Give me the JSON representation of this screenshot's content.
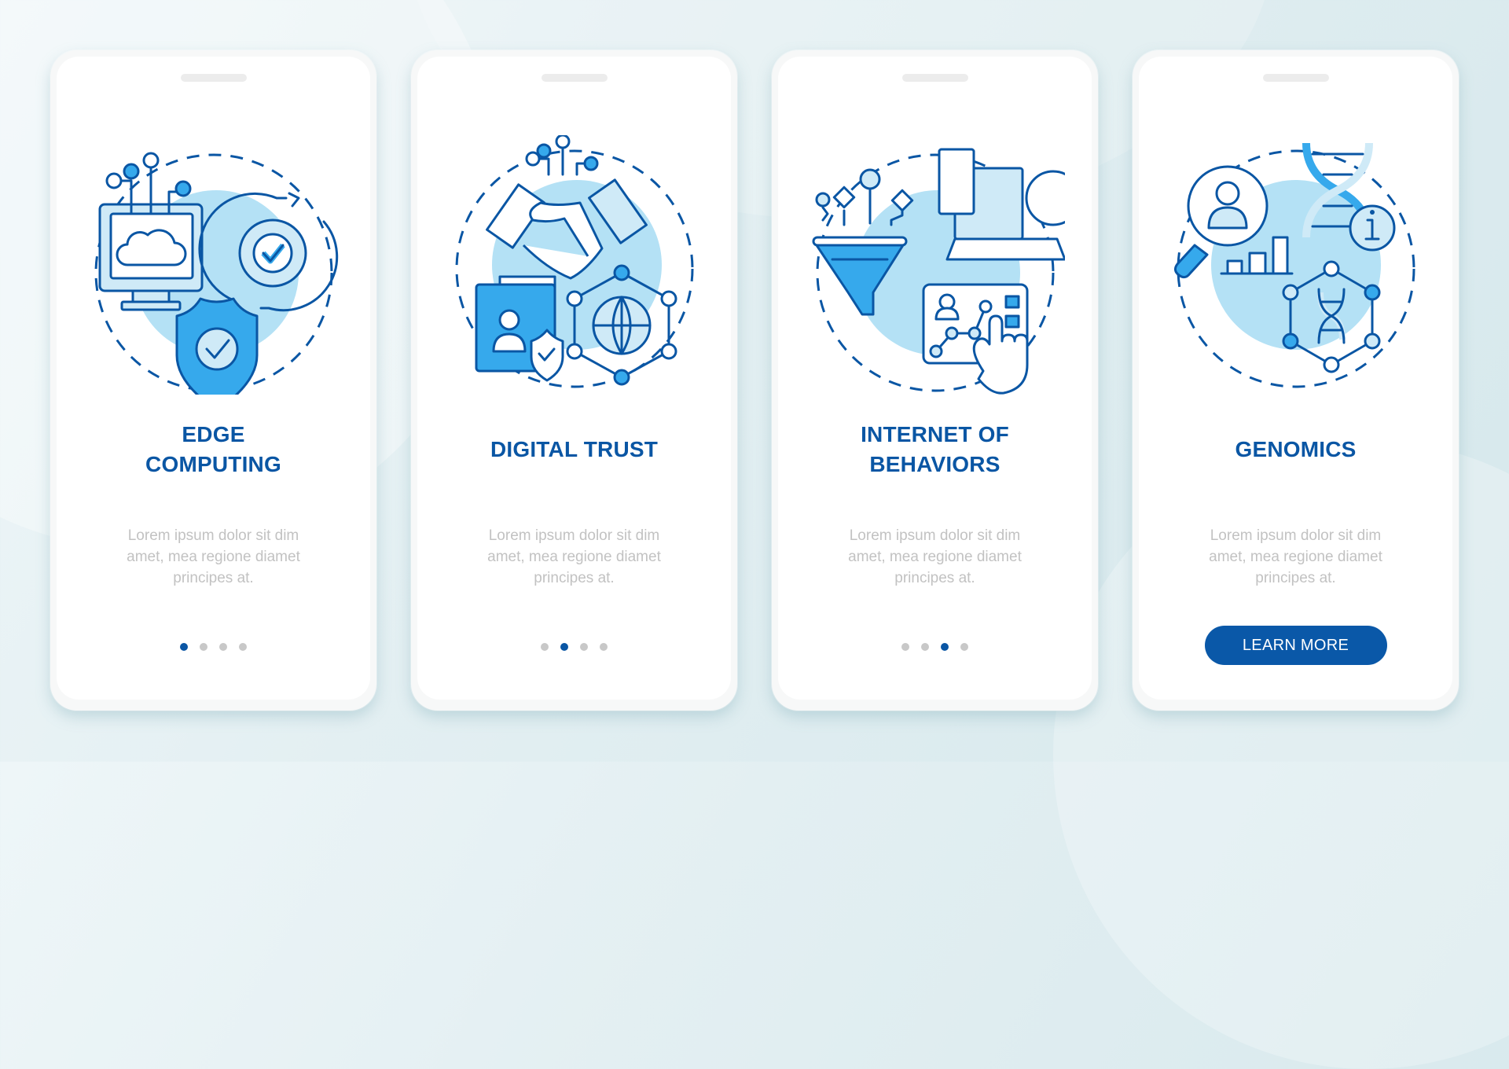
{
  "colors": {
    "accent": "#0a56a4",
    "icon_fill": "#36a9ec",
    "icon_light": "#cfeaf7",
    "body_text": "#c2c2c2",
    "dot_inactive": "#c8c8c8"
  },
  "screens": [
    {
      "title_lines": [
        "EDGE",
        "COMPUTING"
      ],
      "illustration": "edge-computing-illustration",
      "description_lines": [
        "Lorem ipsum dolor sit dim",
        "amet, mea regione diamet",
        "principes at."
      ],
      "pagination": {
        "total": 4,
        "active": 1
      }
    },
    {
      "title_lines": [
        "DIGITAL TRUST"
      ],
      "illustration": "digital-trust-illustration",
      "description_lines": [
        "Lorem ipsum dolor sit dim",
        "amet, mea regione diamet",
        "principes at."
      ],
      "pagination": {
        "total": 4,
        "active": 2
      }
    },
    {
      "title_lines": [
        "INTERNET OF",
        "BEHAVIORS"
      ],
      "illustration": "internet-of-behaviors-illustration",
      "description_lines": [
        "Lorem ipsum dolor sit dim",
        "amet, mea regione diamet",
        "principes at."
      ],
      "pagination": {
        "total": 4,
        "active": 3
      }
    },
    {
      "title_lines": [
        "GENOMICS"
      ],
      "illustration": "genomics-illustration",
      "description_lines": [
        "Lorem ipsum dolor sit dim",
        "amet, mea regione diamet",
        "principes at."
      ],
      "button": {
        "label": "LEARN MORE"
      }
    }
  ]
}
